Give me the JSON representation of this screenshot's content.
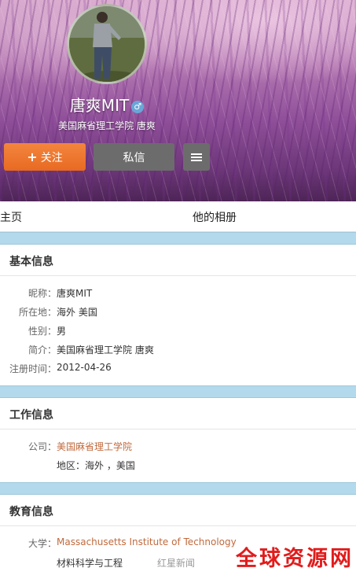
{
  "profile": {
    "name": "唐爽MIT",
    "gender_symbol": "♂",
    "bio": "美国麻省理工学院 唐爽"
  },
  "buttons": {
    "follow": "关注",
    "follow_icon": "+",
    "message": "私信"
  },
  "tabs": [
    "主页",
    "他的相册"
  ],
  "basic": {
    "title": "基本信息",
    "rows": [
      {
        "key": "昵称：",
        "value": "唐爽MIT"
      },
      {
        "key": "所在地：",
        "value": "海外 美国"
      },
      {
        "key": "性别：",
        "value": "男"
      },
      {
        "key": "简介：",
        "value": "美国麻省理工学院 唐爽"
      },
      {
        "key": "注册时间：",
        "value": "2012-04-26"
      }
    ]
  },
  "work": {
    "title": "工作信息",
    "company_key": "公司：",
    "company": "美国麻省理工学院",
    "region": "地区：海外 ，美国"
  },
  "education": {
    "title": "教育信息",
    "school_key": "大学：",
    "school": "Massachusetts Institute of Technology",
    "major": "材料科学与工程"
  },
  "watermarks": {
    "faint": "红星新闻",
    "main": "全球资源网"
  },
  "colors": {
    "follow_orange": "#e86a22",
    "link": "#c06a3e",
    "divider_blue": "#b3d9ec",
    "watermark_red": "#e11c1c"
  }
}
